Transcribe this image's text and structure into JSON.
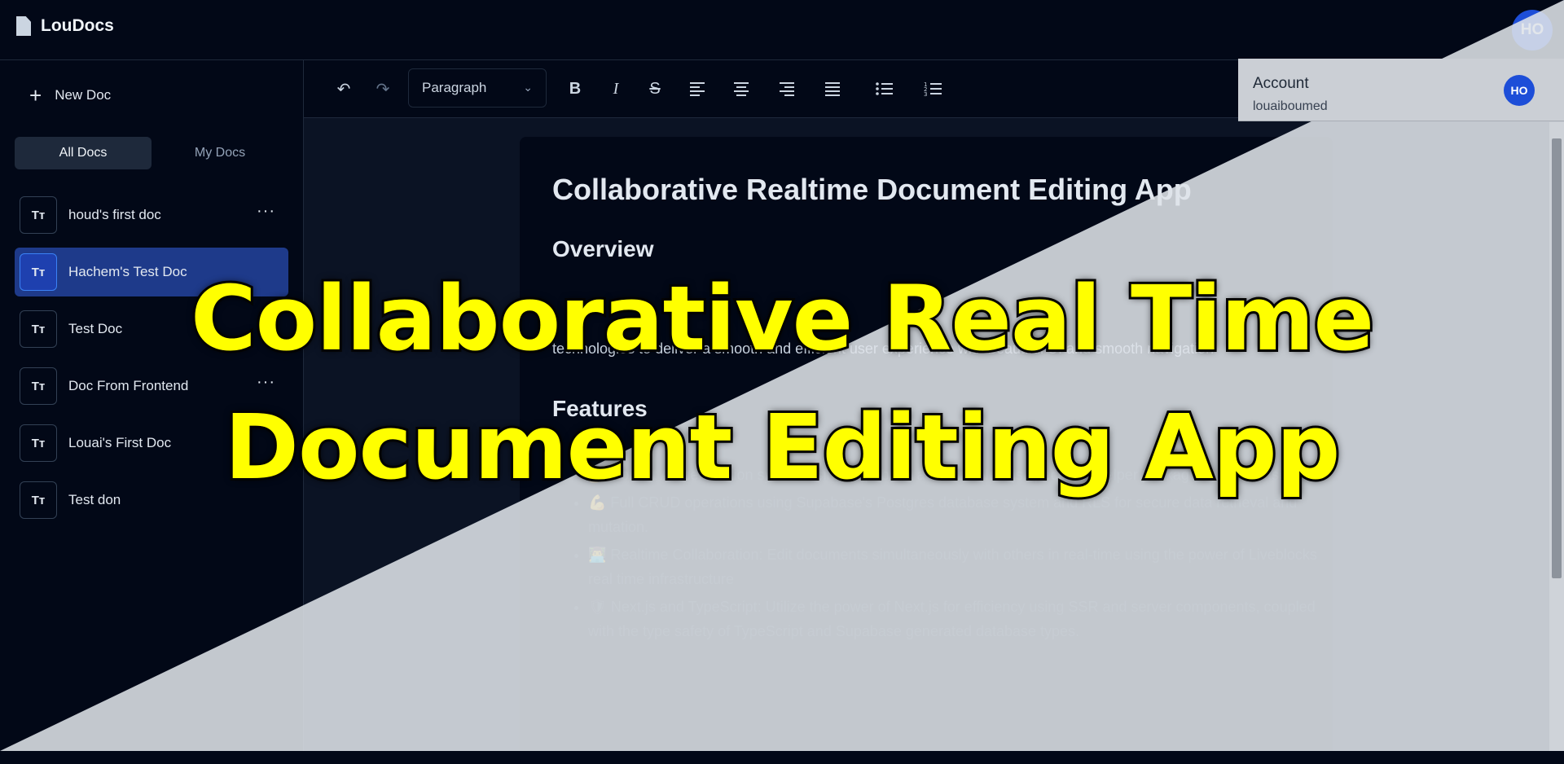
{
  "app": {
    "name": "LouDocs",
    "avatar_initials": "HO"
  },
  "sidebar": {
    "new_doc_label": "New Doc",
    "tabs": [
      "All Docs",
      "My Docs"
    ],
    "docs": [
      {
        "icon": "Tт",
        "name": "houd's first doc",
        "menu": "···"
      },
      {
        "icon": "Tт",
        "name": "Hachem's Test Doc",
        "menu": ""
      },
      {
        "icon": "Tт",
        "name": "Test Doc",
        "menu": ""
      },
      {
        "icon": "Tт",
        "name": "Doc From Frontend",
        "menu": "···"
      },
      {
        "icon": "Tт",
        "name": "Louai's First Doc",
        "menu": ""
      },
      {
        "icon": "Tт",
        "name": "Test don",
        "menu": ""
      }
    ]
  },
  "toolbar": {
    "undo": "↶",
    "redo": "↷",
    "block_type": "Paragraph",
    "bold": "B",
    "italic": "I",
    "strike": "S"
  },
  "document": {
    "title": "Collaborative Realtime Document Editing App",
    "overview_heading": "Overview",
    "overview_text": "technologies to deliver a smooth and efficient user experience with beautiful UI and smooth navigation",
    "features_heading": "Features",
    "features": [
      "🔐 Robust Authentication system using Supabase auth and Next.js specifique helper package by Supabase.",
      "💪 Full CRUD operations using Supabase's Postgres database system and RLS for secure data retrieval and mutation.",
      "👨‍💻 Realtime Collaboration: Edit documents simultaneously with others in real-time using the power of Liveblocks real time infrastructure",
      "🛡 Next.js and TypeScript: Utilize the power of Next.js for efficiency using SSR and server components, coupled with the type safety of TypeScript and Supabase generated database types."
    ]
  },
  "account": {
    "label": "Account",
    "email": "louaiboumed",
    "avatar_initials": "HO"
  },
  "banner": {
    "line1": "Collaborative Real Time",
    "line2": "Document Editing App"
  },
  "colors": {
    "background": "#020817",
    "active_doc": "#1e3a8a",
    "avatar": "#1d4ed8",
    "banner_text": "#ffff00"
  }
}
